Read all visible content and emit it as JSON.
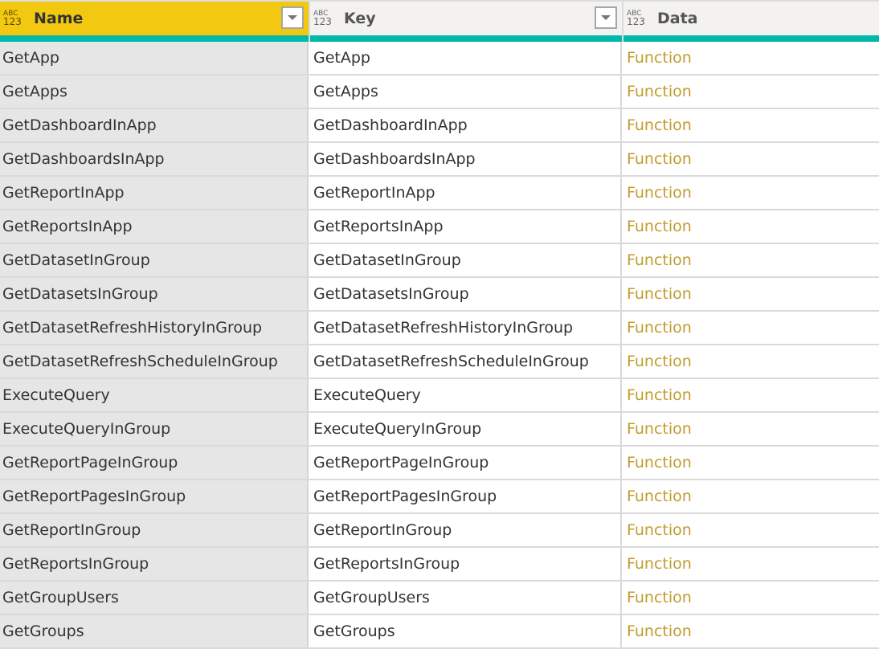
{
  "columns": [
    {
      "label": "Name",
      "type_icon": [
        "ABC",
        "123"
      ],
      "selected": true,
      "has_filter": true
    },
    {
      "label": "Key",
      "type_icon": [
        "ABC",
        "123"
      ],
      "selected": false,
      "has_filter": true
    },
    {
      "label": "Data",
      "type_icon": [
        "ABC",
        "123"
      ],
      "selected": false,
      "has_filter": false
    }
  ],
  "colors": {
    "selected_header": "#f2c811",
    "quality_bar": "#01b8aa",
    "function_link": "#c19c2e"
  },
  "rows": [
    {
      "name": "GetApp",
      "key": "GetApp",
      "data": "Function"
    },
    {
      "name": "GetApps",
      "key": "GetApps",
      "data": "Function"
    },
    {
      "name": "GetDashboardInApp",
      "key": "GetDashboardInApp",
      "data": "Function"
    },
    {
      "name": "GetDashboardsInApp",
      "key": "GetDashboardsInApp",
      "data": "Function"
    },
    {
      "name": "GetReportInApp",
      "key": "GetReportInApp",
      "data": "Function"
    },
    {
      "name": "GetReportsInApp",
      "key": "GetReportsInApp",
      "data": "Function"
    },
    {
      "name": "GetDatasetInGroup",
      "key": "GetDatasetInGroup",
      "data": "Function"
    },
    {
      "name": "GetDatasetsInGroup",
      "key": "GetDatasetsInGroup",
      "data": "Function"
    },
    {
      "name": "GetDatasetRefreshHistoryInGroup",
      "key": "GetDatasetRefreshHistoryInGroup",
      "data": "Function"
    },
    {
      "name": "GetDatasetRefreshScheduleInGroup",
      "key": "GetDatasetRefreshScheduleInGroup",
      "data": "Function"
    },
    {
      "name": "ExecuteQuery",
      "key": "ExecuteQuery",
      "data": "Function"
    },
    {
      "name": "ExecuteQueryInGroup",
      "key": "ExecuteQueryInGroup",
      "data": "Function"
    },
    {
      "name": "GetReportPageInGroup",
      "key": "GetReportPageInGroup",
      "data": "Function"
    },
    {
      "name": "GetReportPagesInGroup",
      "key": "GetReportPagesInGroup",
      "data": "Function"
    },
    {
      "name": "GetReportInGroup",
      "key": "GetReportInGroup",
      "data": "Function"
    },
    {
      "name": "GetReportsInGroup",
      "key": "GetReportsInGroup",
      "data": "Function"
    },
    {
      "name": "GetGroupUsers",
      "key": "GetGroupUsers",
      "data": "Function"
    },
    {
      "name": "GetGroups",
      "key": "GetGroups",
      "data": "Function"
    }
  ]
}
